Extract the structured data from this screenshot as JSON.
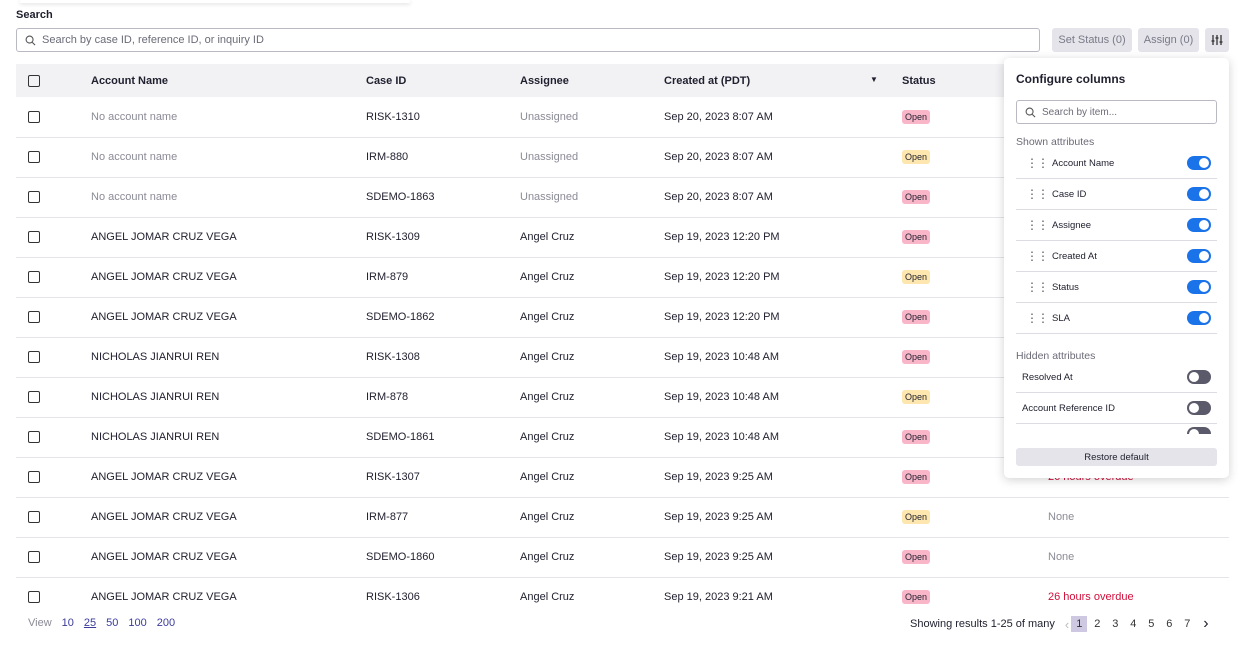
{
  "search": {
    "label": "Search",
    "placeholder": "Search by case ID, reference ID, or inquiry ID"
  },
  "toolbar": {
    "set_status": "Set Status (0)",
    "assign": "Assign (0)",
    "configure_icon": "sliders-icon"
  },
  "table": {
    "headers": [
      "Account Name",
      "Case ID",
      "Assignee",
      "Created at (PDT)",
      "Status"
    ],
    "rows": [
      {
        "account": "No account name",
        "case": "RISK-1310",
        "assignee": "Unassigned",
        "created": "Sep 20, 2023 8:07 AM",
        "status": "Open",
        "status_color": "pink",
        "sla": ""
      },
      {
        "account": "No account name",
        "case": "IRM-880",
        "assignee": "Unassigned",
        "created": "Sep 20, 2023 8:07 AM",
        "status": "Open",
        "status_color": "yellow",
        "sla": ""
      },
      {
        "account": "No account name",
        "case": "SDEMO-1863",
        "assignee": "Unassigned",
        "created": "Sep 20, 2023 8:07 AM",
        "status": "Open",
        "status_color": "pink",
        "sla": ""
      },
      {
        "account": "ANGEL JOMAR CRUZ VEGA",
        "case": "RISK-1309",
        "assignee": "Angel Cruz",
        "created": "Sep 19, 2023 12:20 PM",
        "status": "Open",
        "status_color": "pink",
        "sla": ""
      },
      {
        "account": "ANGEL JOMAR CRUZ VEGA",
        "case": "IRM-879",
        "assignee": "Angel Cruz",
        "created": "Sep 19, 2023 12:20 PM",
        "status": "Open",
        "status_color": "yellow",
        "sla": ""
      },
      {
        "account": "ANGEL JOMAR CRUZ VEGA",
        "case": "SDEMO-1862",
        "assignee": "Angel Cruz",
        "created": "Sep 19, 2023 12:20 PM",
        "status": "Open",
        "status_color": "pink",
        "sla": ""
      },
      {
        "account": "NICHOLAS JIANRUI REN",
        "case": "RISK-1308",
        "assignee": "Angel Cruz",
        "created": "Sep 19, 2023 10:48 AM",
        "status": "Open",
        "status_color": "pink",
        "sla": ""
      },
      {
        "account": "NICHOLAS JIANRUI REN",
        "case": "IRM-878",
        "assignee": "Angel Cruz",
        "created": "Sep 19, 2023 10:48 AM",
        "status": "Open",
        "status_color": "yellow",
        "sla": ""
      },
      {
        "account": "NICHOLAS JIANRUI REN",
        "case": "SDEMO-1861",
        "assignee": "Angel Cruz",
        "created": "Sep 19, 2023 10:48 AM",
        "status": "Open",
        "status_color": "pink",
        "sla": ""
      },
      {
        "account": "ANGEL JOMAR CRUZ VEGA",
        "case": "RISK-1307",
        "assignee": "Angel Cruz",
        "created": "Sep 19, 2023 9:25 AM",
        "status": "Open",
        "status_color": "pink",
        "sla": "26 hours overdue"
      },
      {
        "account": "ANGEL JOMAR CRUZ VEGA",
        "case": "IRM-877",
        "assignee": "Angel Cruz",
        "created": "Sep 19, 2023 9:25 AM",
        "status": "Open",
        "status_color": "yellow",
        "sla": "None"
      },
      {
        "account": "ANGEL JOMAR CRUZ VEGA",
        "case": "SDEMO-1860",
        "assignee": "Angel Cruz",
        "created": "Sep 19, 2023 9:25 AM",
        "status": "Open",
        "status_color": "pink",
        "sla": "None"
      },
      {
        "account": "ANGEL JOMAR CRUZ VEGA",
        "case": "RISK-1306",
        "assignee": "Angel Cruz",
        "created": "Sep 19, 2023 9:21 AM",
        "status": "Open",
        "status_color": "pink",
        "sla": "26 hours overdue"
      }
    ]
  },
  "colors": {
    "pink": "#f9b6c8",
    "yellow": "#fde7ae",
    "toggle_on": "#1a73e8",
    "overdue": "#d0103a"
  },
  "panel": {
    "title": "Configure columns",
    "search_placeholder": "Search by item...",
    "shown_label": "Shown attributes",
    "hidden_label": "Hidden attributes",
    "shown": [
      "Account Name",
      "Case ID",
      "Assignee",
      "Created At",
      "Status",
      "SLA"
    ],
    "hidden": [
      "Resolved At",
      "Account Reference ID"
    ],
    "restore": "Restore default"
  },
  "footer": {
    "view_label": "View",
    "view_options": [
      "10",
      "25",
      "50",
      "100",
      "200"
    ],
    "view_selected": "25",
    "showing": "Showing results 1-25 of many",
    "pages": [
      "1",
      "2",
      "3",
      "4",
      "5",
      "6",
      "7"
    ],
    "current_page": "1"
  }
}
